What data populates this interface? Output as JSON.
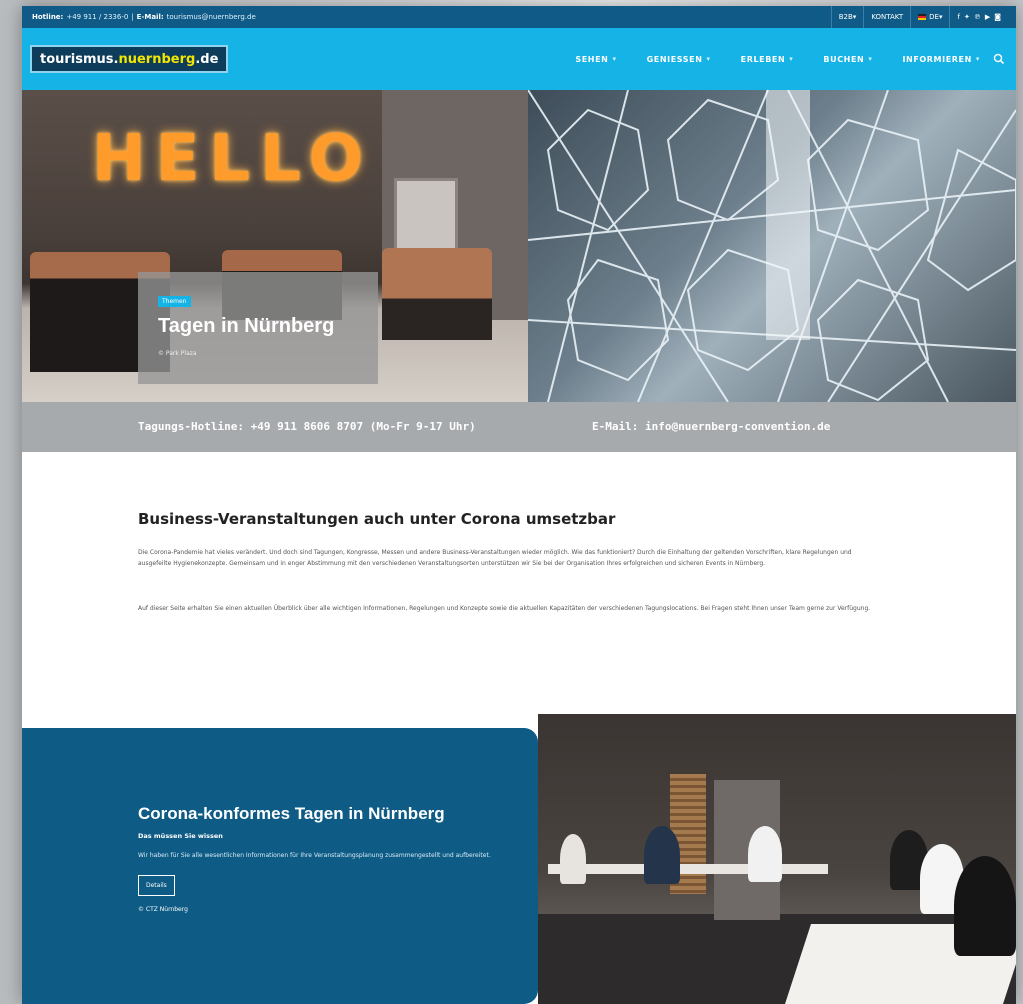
{
  "topbar": {
    "hotline_label": "Hotline:",
    "hotline_number": "+49 911 / 2336-0",
    "email_label": "E-Mail:",
    "email_value": "tourismus@nuernberg.de",
    "b2b": "B2B",
    "b2b_chevron": "▾",
    "kontakt": "KONTAKT",
    "lang": "DE",
    "lang_chevron": "▾",
    "social_icons": [
      "facebook-icon",
      "twitter-icon",
      "pinterest-icon",
      "youtube-icon",
      "instagram-icon"
    ]
  },
  "nav": {
    "logo_part1": "tourismus.",
    "logo_part2": "nuernberg",
    "logo_part3": ".de",
    "items": [
      {
        "label": "SEHEN"
      },
      {
        "label": "GENIESSEN"
      },
      {
        "label": "ERLEBEN"
      },
      {
        "label": "BUCHEN"
      },
      {
        "label": "INFORMIEREN"
      }
    ],
    "chevron": "▾",
    "search_icon": "search-icon"
  },
  "hero": {
    "sign_text": "HELLO",
    "badge": "Themen",
    "title": "Tagen in Nürnberg",
    "credit": "© Park Plaza"
  },
  "hotline_band": {
    "phone": "Tagungs-Hotline: +49 911 8606 8707 (Mo-Fr 9-17 Uhr)",
    "email": "E-Mail: info@nuernberg-convention.de"
  },
  "content": {
    "title": "Business-Veranstaltungen auch unter Corona umsetzbar",
    "paragraph1": "Die Corona-Pandemie hat vieles verändert. Und doch sind Tagungen, Kongresse, Messen und andere Business-Veranstaltungen wieder möglich. Wie das funktioniert? Durch die Einhaltung der geltenden Vorschriften, klare Regelungen und ausgefeilte Hygienekonzepte. Gemeinsam und in enger Abstimmung mit den verschiedenen Veranstaltungsorten unterstützen wir Sie bei der Organisation Ihres erfolgreichen und sicheren Events in Nürnberg.",
    "paragraph2": "Auf dieser Seite erhalten Sie einen aktuellen Überblick über alle wichtigen Informationen, Regelungen und Konzepte sowie die aktuellen Kapazitäten der verschiedenen Tagungslocations. Bei Fragen steht Ihnen unser Team gerne zur Verfügung."
  },
  "corona_card": {
    "title": "Corona-konformes Tagen in Nürnberg",
    "subtitle": "Das müssen Sie wissen",
    "text": "Wir haben für Sie alle wesentlichen Informationen für Ihre Veranstaltungsplanung zusammengestellt und aufbereitet.",
    "button": "Details",
    "credit": "© CTZ Nürnberg"
  },
  "colors": {
    "topbar": "#0f5a86",
    "nav": "#16b3e6",
    "hotline_band": "#a7aaad",
    "card": "#0e5b85"
  }
}
